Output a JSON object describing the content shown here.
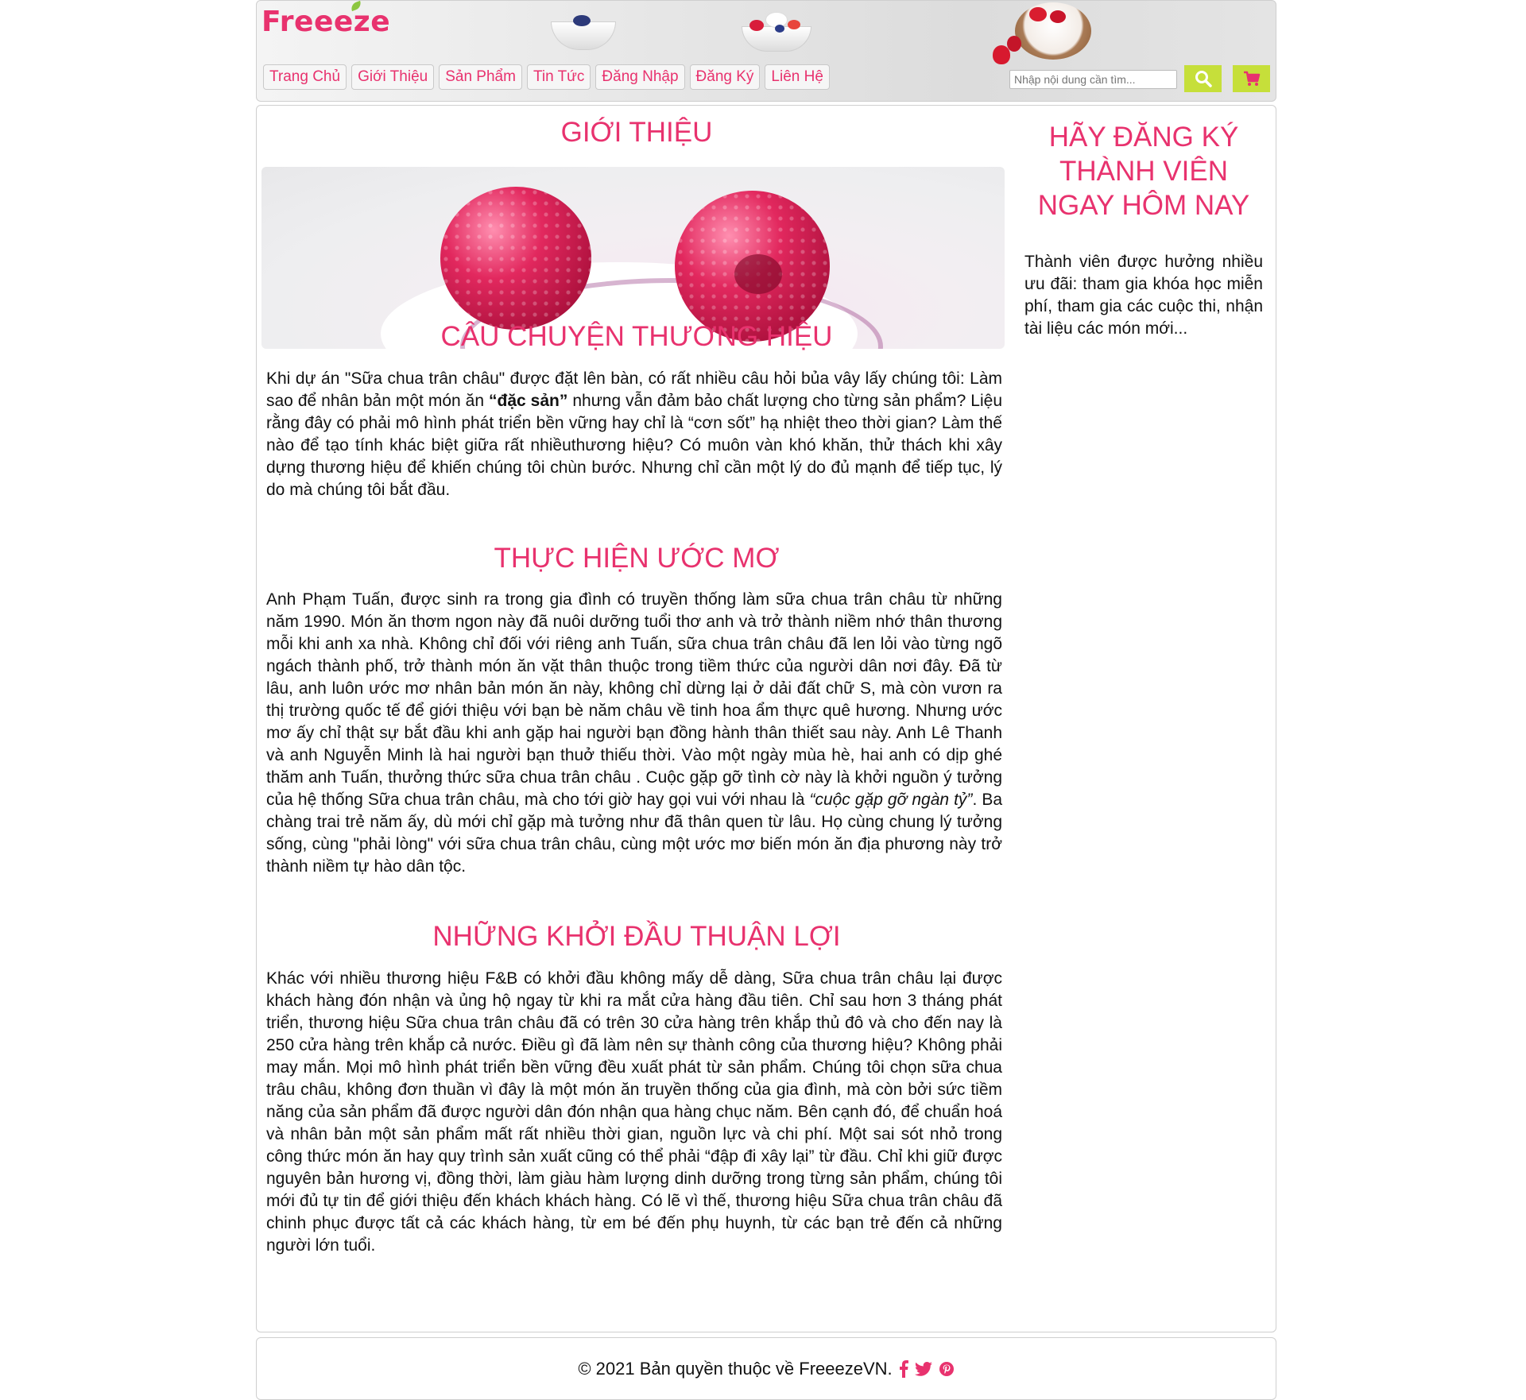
{
  "brand": {
    "logo_text": "Freeeze",
    "accent": "#e8326e",
    "button_color": "#c6df3a"
  },
  "nav": {
    "items": [
      {
        "label": "Trang Chủ"
      },
      {
        "label": "Giới Thiệu"
      },
      {
        "label": "Sản Phẩm"
      },
      {
        "label": "Tin Tức"
      },
      {
        "label": "Đăng Nhập"
      },
      {
        "label": "Đăng Ký"
      },
      {
        "label": "Liên Hệ"
      }
    ]
  },
  "search": {
    "placeholder": "Nhập nội dung cần tìm..."
  },
  "icons": {
    "search": "search-icon",
    "cart": "cart-icon"
  },
  "main": {
    "title": "GIỚI THIỆU",
    "sections": [
      {
        "title": "CÂU CHUYỆN THƯƠNG HIỆU",
        "text_before": "Khi dự án \"Sữa chua trân châu\" được đặt lên bàn, có rất nhiều câu hỏi bủa vây lấy chúng tôi: Làm sao để nhân bản một món ăn ",
        "bold": "“đặc sản”",
        "text_after": " nhưng vẫn đảm bảo chất lượng cho từng sản phẩm? Liệu rằng đây có phải mô hình phát triển bền vững hay chỉ là “cơn sốt” hạ nhiệt theo thời gian? Làm thế nào để tạo tính khác biệt giữa rất nhiềuthương hiệu? Có muôn vàn khó khăn, thử thách khi xây dựng thương hiệu để khiến chúng tôi chùn bước. Nhưng chỉ cần một lý do đủ mạnh để tiếp tục, lý do mà chúng tôi bắt đầu."
      },
      {
        "title": "THỰC HIỆN ƯỚC MƠ",
        "text_before": "Anh Phạm Tuấn, được sinh ra trong gia đình có truyền thống làm sữa chua trân châu từ những năm 1990. Món ăn thơm ngon này đã nuôi dưỡng tuổi thơ anh và trở thành niềm nhớ thân thương mỗi khi anh xa nhà. Không chỉ đối với riêng anh Tuấn, sữa chua trân châu đã len lỏi vào từng ngõ ngách thành phố, trở thành món ăn vặt thân thuộc trong tiềm thức của người dân nơi đây. Đã từ lâu, anh luôn ước mơ nhân bản món ăn này, không chỉ dừng lại ở dải đất chữ S, mà còn vươn ra thị trường quốc tế để giới thiệu với bạn bè năm châu về tinh hoa ẩm thực quê hương. Nhưng ước mơ ấy chỉ thật sự bắt đầu khi anh gặp hai người bạn đồng hành thân thiết sau này. Anh Lê Thanh và anh Nguyễn Minh là hai người bạn thuở thiếu thời. Vào một ngày mùa hè, hai anh có dịp ghé thăm anh Tuấn, thưởng thức sữa chua trân châu . Cuộc gặp gỡ tình cờ này là khởi nguồn ý tưởng của hệ thống Sữa chua trân châu, mà cho tới giờ hay gọi vui với nhau là ",
        "italic": "“cuộc gặp gỡ ngàn tỷ”",
        "text_after": ". Ba chàng trai trẻ năm ấy, dù mới chỉ gặp mà tưởng như đã thân quen từ lâu. Họ cùng chung lý tưởng sống, cùng \"phải lòng\" với sữa chua trân châu, cùng một ước mơ biến món ăn địa phương này trở thành niềm tự hào dân tộc."
      },
      {
        "title": "NHỮNG KHỞI ĐẦU THUẬN LỢI",
        "text": "Khác với nhiều thương hiệu F&B có khởi đầu không mấy dễ dàng, Sữa chua trân châu lại được khách hàng đón nhận và ủng hộ ngay từ khi ra mắt cửa hàng đầu tiên. Chỉ sau hơn 3 tháng phát triển, thương hiệu Sữa chua trân châu đã có trên 30 cửa hàng trên khắp thủ đô và cho đến nay là 250 cửa hàng trên khắp cả nước. Điều gì đã làm nên sự thành công của thương hiệu? Không phải may mắn. Mọi mô hình phát triển bền vững đều xuất phát từ sản phẩm. Chúng tôi chọn sữa chua trâu châu, không đơn thuần vì đây là một món ăn truyền thống của gia đình, mà còn bởi sức tiềm năng của sản phẩm đã được người dân đón nhận qua hàng chục năm. Bên cạnh đó, để chuẩn hoá và nhân bản một sản phẩm mất rất nhiều thời gian, nguồn lực và chi phí. Một sai sót nhỏ trong công thức món ăn hay quy trình sản xuất cũng có thể phải “đập đi xây lại” từ đầu. Chỉ khi giữ được nguyên bản hương vị, đồng thời, làm giàu hàm lượng dinh dưỡng trong từng sản phẩm, chúng tôi mới đủ tự tin để giới thiệu đến khách khách hàng. Có lẽ vì thế, thương hiệu Sữa chua trân châu đã chinh phục được tất cả các khách hàng, từ em bé đến phụ huynh, từ các bạn trẻ đến cả những người lớn tuổi."
      }
    ]
  },
  "sidebar": {
    "title_lines": [
      "HÃY ĐĂNG KÝ",
      "THÀNH VIÊN",
      "NGAY HÔM NAY"
    ],
    "text": "Thành viên được hưởng nhiều ưu đãi: tham gia khóa học miễn phí, tham gia các cuộc thi, nhận tài liệu các món mới..."
  },
  "footer": {
    "copyright": "© 2021 Bản quyền thuộc về FreeezeVN.",
    "social": [
      "facebook-icon",
      "twitter-icon",
      "pinterest-icon"
    ]
  }
}
